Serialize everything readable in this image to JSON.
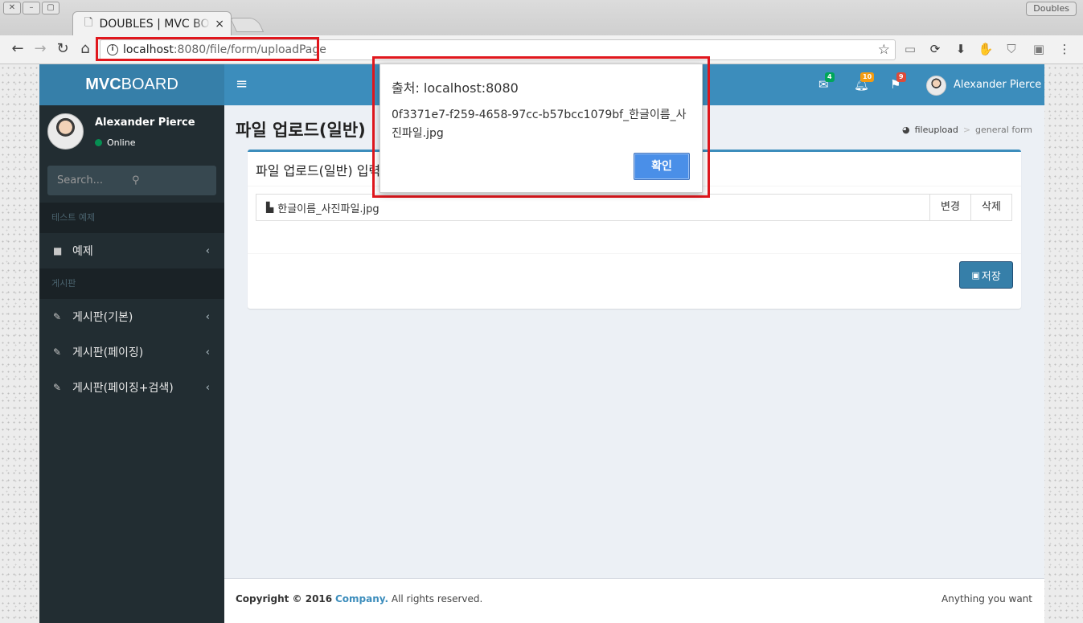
{
  "browser": {
    "tab_title": "DOUBLES | MVC BOARD",
    "tab_close": "×",
    "profile": "Doubles",
    "url_host": "localhost",
    "url_path": ":8080/file/form/uploadPage",
    "nav": {
      "back": "←",
      "forward": "→",
      "reload": "↻",
      "home": "⌂"
    },
    "star": "☆"
  },
  "sidebar": {
    "logo_bold": "MVC",
    "logo_rest": "BOARD",
    "user_name": "Alexander Pierce",
    "user_status": "Online",
    "search_placeholder": "Search...",
    "sections": [
      {
        "header": "테스트 예제",
        "items": [
          {
            "label": "예제",
            "icon": "folder-icon"
          }
        ]
      },
      {
        "header": "게시판",
        "items": [
          {
            "label": "게시판(기본)",
            "icon": "edit-icon"
          },
          {
            "label": "게시판(페이징)",
            "icon": "edit-icon"
          },
          {
            "label": "게시판(페이징+검색)",
            "icon": "edit-icon"
          }
        ]
      }
    ]
  },
  "topnav": {
    "menu": "≡",
    "badges": {
      "messages": "4",
      "notifications": "10",
      "tasks": "9"
    },
    "badge_colors": {
      "messages": "#00a65a",
      "notifications": "#f39c12",
      "tasks": "#dd4b39"
    },
    "user_name": "Alexander Pierce"
  },
  "page": {
    "title": "파일 업로드(일반)",
    "breadcrumb": {
      "home": "fileupload",
      "active": "general form",
      "sep": ">"
    },
    "box_title": "파일 업로드(일반) 입력",
    "file_name": "한글이름_사진파일.jpg",
    "change_label": "변경",
    "delete_label": "삭제",
    "save_label": "저장"
  },
  "footer": {
    "copyright": "Copyright © 2016",
    "company": "Company.",
    "rights": "All rights reserved.",
    "right_text": "Anything you want"
  },
  "dialog": {
    "title": "출처: localhost:8080",
    "message": "0f3371e7-f259-4658-97cc-b57bcc1079bf_한글이름_사진파일.jpg",
    "ok_label": "확인"
  },
  "colors": {
    "header_blue": "#3c8dbc",
    "logo_blue": "#367fa9",
    "sidebar_dark": "#222d32",
    "highlight_red": "#e0171d"
  }
}
